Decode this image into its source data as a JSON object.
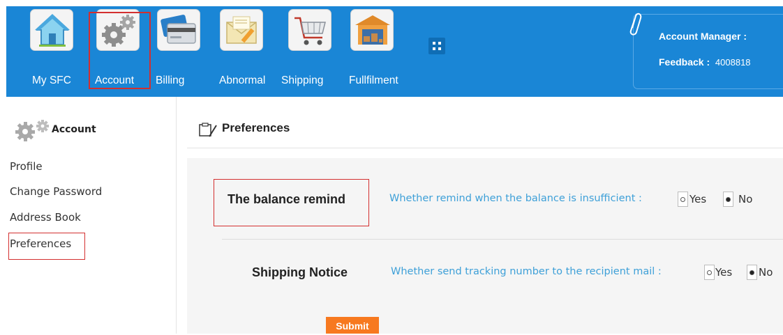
{
  "nav": {
    "items": [
      {
        "label": "My SFC",
        "icon": "home-icon"
      },
      {
        "label": "Account",
        "icon": "gears-icon"
      },
      {
        "label": "Billing",
        "icon": "credit-card-icon"
      },
      {
        "label": "Abnormal",
        "icon": "envelope-pencil-icon"
      },
      {
        "label": "Shipping",
        "icon": "shopping-cart-icon"
      },
      {
        "label": "Fullfilment",
        "icon": "warehouse-icon"
      }
    ],
    "active": "Account",
    "bar_color": "#1a86d6",
    "highlight_color": "#d32f2f"
  },
  "account_panel": {
    "manager_label": "Account Manager :",
    "feedback_label": "Feedback :",
    "feedback_value": "4008818"
  },
  "sidebar": {
    "title": "Account",
    "links": [
      "Profile",
      "Change Password",
      "Address Book",
      "Preferences"
    ],
    "active": "Preferences"
  },
  "main": {
    "title": "Preferences",
    "rows": [
      {
        "label": "The balance remind",
        "question": "Whether remind when the balance is insufficient :",
        "yes_label": "Yes",
        "no_label": "No",
        "selected": "No"
      },
      {
        "label": "Shipping Notice",
        "question": "Whether send tracking number to the recipient mail :",
        "yes_label": "Yes",
        "no_label": "No",
        "selected": "No"
      }
    ],
    "submit_label": "Submit",
    "link_color": "#3ea0d8",
    "submit_color": "#f7791f"
  }
}
